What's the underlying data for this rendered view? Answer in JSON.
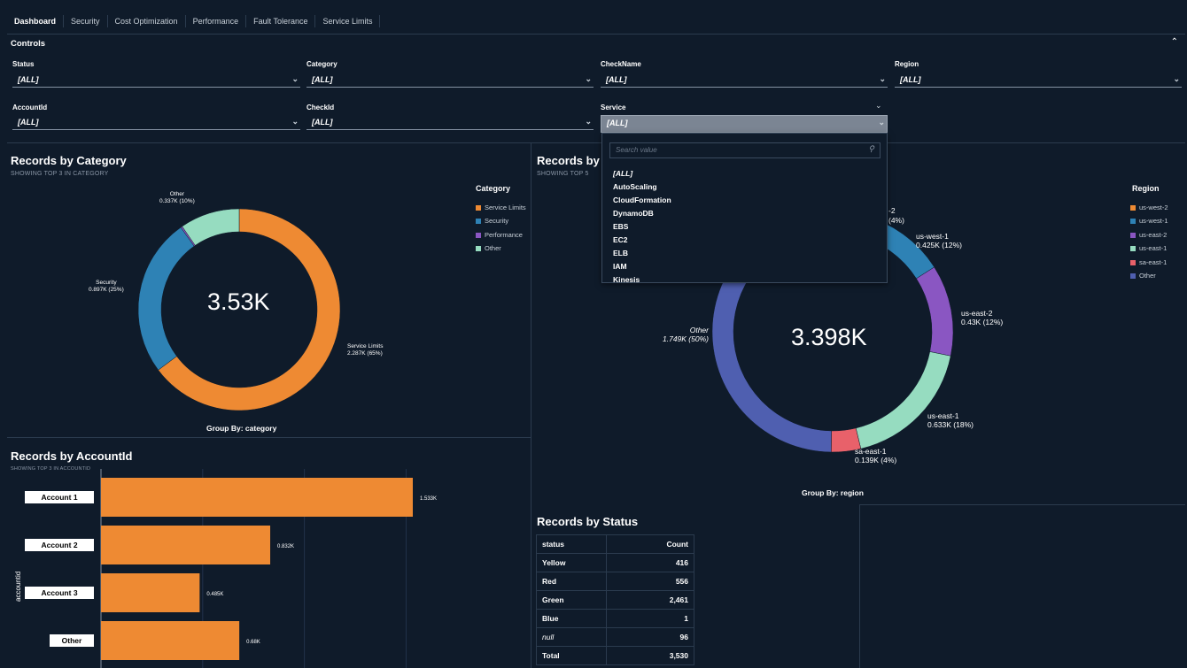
{
  "tabs": [
    "Dashboard",
    "Security",
    "Cost Optimization",
    "Performance",
    "Fault Tolerance",
    "Service Limits"
  ],
  "controls": {
    "title": "Controls",
    "collapse_icon": "chevron-up-icon",
    "filters": {
      "status": {
        "label": "Status",
        "value": "[ALL]"
      },
      "category": {
        "label": "Category",
        "value": "[ALL]"
      },
      "checkname": {
        "label": "CheckName",
        "value": "[ALL]"
      },
      "region": {
        "label": "Region",
        "value": "[ALL]"
      },
      "accountid": {
        "label": "AccountId",
        "value": "[ALL]"
      },
      "checkid": {
        "label": "CheckId",
        "value": "[ALL]"
      },
      "service": {
        "label": "Service",
        "value": "[ALL]"
      }
    }
  },
  "service_dropdown": {
    "search_placeholder": "Search value",
    "options": [
      "[ALL]",
      "AutoScaling",
      "CloudFormation",
      "DynamoDB",
      "EBS",
      "EC2",
      "ELB",
      "IAM",
      "Kinesis"
    ]
  },
  "panels": {
    "category": {
      "title": "Records by Category",
      "subtitle": "SHOWING TOP 3 IN CATEGORY",
      "center": "3.53K",
      "legend_title": "Category",
      "group_by": "Group By: category"
    },
    "region": {
      "title": "Records by R",
      "subtitle": "SHOWING TOP 5",
      "center": "3.398K",
      "legend_title": "Region",
      "group_by": "Group By: region",
      "partial_label_1": "-2",
      "partial_label_2": "(4%)"
    },
    "account": {
      "title": "Records by AccountId",
      "subtitle": "SHOWING TOP 3 IN ACCOUNTID",
      "axis_title": "accountid"
    },
    "status": {
      "title": "Records by Status",
      "headers": [
        "status",
        "Count"
      ],
      "rows": [
        [
          "Yellow",
          "416"
        ],
        [
          "Red",
          "556"
        ],
        [
          "Green",
          "2,461"
        ],
        [
          "Blue",
          "1"
        ],
        [
          "null",
          "96"
        ],
        [
          "Total",
          "3,530"
        ]
      ]
    }
  },
  "chart_data": [
    {
      "type": "pie",
      "categories": [
        "Service Limits",
        "Security",
        "Performance",
        "Other"
      ],
      "values": [
        2.287,
        0.897,
        0.009,
        0.337
      ],
      "slice_labels": [
        "Service Limits\n2.287K (65%)",
        "Security\n0.897K (25%)",
        "",
        "Other\n0.337K (10%)"
      ],
      "colors": [
        "#ee8a33",
        "#2e82b5",
        "#8a56c2",
        "#96dcc0"
      ]
    },
    {
      "type": "pie",
      "categories": [
        "us-west-2",
        "us-west-1",
        "us-east-2",
        "us-east-1",
        "sa-east-1",
        "Other"
      ],
      "values": [
        0.136,
        0.425,
        0.43,
        0.633,
        0.139,
        1.749
      ],
      "slice_labels": [
        "",
        "us-west-1\n0.425K (12%)",
        "us-east-2\n0.43K (12%)",
        "us-east-1\n0.633K (18%)",
        "sa-east-1\n0.139K (4%)",
        "Other\n1.749K (50%)"
      ],
      "colors": [
        "#ee8a33",
        "#2e82b5",
        "#8a56c2",
        "#96dcc0",
        "#e8616a",
        "#4f5fb0"
      ]
    },
    {
      "type": "bar",
      "orientation": "horizontal",
      "categories": [
        "Account 1",
        "Account 2",
        "Account 3",
        "Other"
      ],
      "values": [
        1.533,
        0.832,
        0.485,
        0.68
      ],
      "data_labels": [
        "1.533K",
        "0.832K",
        "0.485K",
        "0.68K"
      ],
      "color": "#ee8a33"
    }
  ]
}
